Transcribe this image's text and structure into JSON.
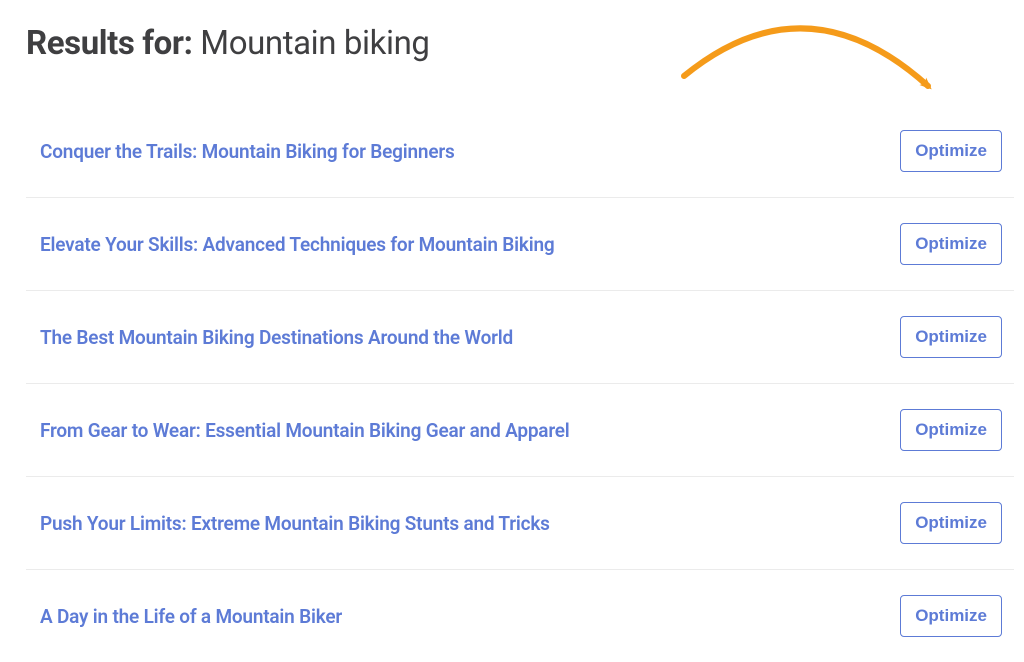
{
  "header": {
    "prefix": "Results for: ",
    "query": "Mountain biking"
  },
  "button_label": "Optimize",
  "results": [
    {
      "title": "Conquer the Trails: Mountain Biking for Beginners"
    },
    {
      "title": "Elevate Your Skills: Advanced Techniques for Mountain Biking"
    },
    {
      "title": "The Best Mountain Biking Destinations Around the World"
    },
    {
      "title": "From Gear to Wear: Essential Mountain Biking Gear and Apparel"
    },
    {
      "title": "Push Your Limits: Extreme Mountain Biking Stunts and Tricks"
    },
    {
      "title": "A Day in the Life of a Mountain Biker"
    }
  ]
}
